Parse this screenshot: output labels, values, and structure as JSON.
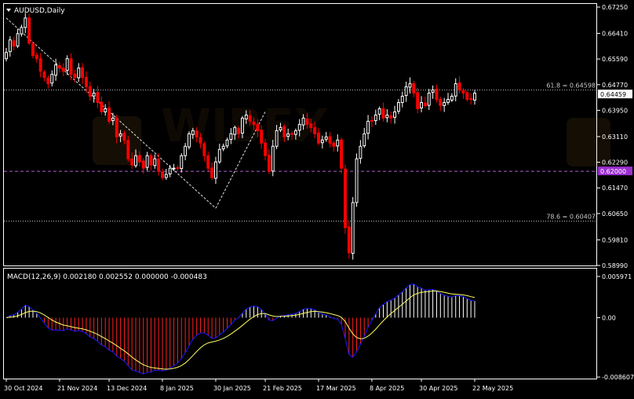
{
  "window": {
    "title": "AUDUSD,Daily",
    "collapse_icon": "triangle-down-icon"
  },
  "colors": {
    "background": "#000000",
    "frame": "#ffffff",
    "bull_candle": "#ffffff",
    "bear_candle": "#ff0000",
    "macd_line": "#1a1aff",
    "signal_line": "#ffff66",
    "hist_positive": "#ffffff",
    "hist_negative": "#ff2020",
    "fib_line": "#c0c0c0",
    "support_line": "#b060d0",
    "current_price_box": "#ffffff",
    "support_price_box": "#9b30d0"
  },
  "chart_data": [
    {
      "type": "candlestick",
      "title": "AUDUSD,Daily",
      "ylim": [
        0.5899,
        0.6725
      ],
      "y_ticks": [
        "0.67250",
        "0.66410",
        "0.65590",
        "0.64770",
        "0.63950",
        "0.63110",
        "0.62290",
        "0.61470",
        "0.60650",
        "0.59810",
        "0.58990"
      ],
      "x_ticks": [
        "30 Oct 2024",
        "21 Nov 2024",
        "13 Dec 2024",
        "8 Jan 2025",
        "30 Jan 2025",
        "21 Feb 2025",
        "17 Mar 2025",
        "8 Apr 2025",
        "30 Apr 2025",
        "22 May 2025"
      ],
      "grid": false,
      "current_price": "0.64459",
      "horizontal_levels": [
        {
          "label": "61.8 = 0.64598",
          "value": 0.64598,
          "style": "dotted"
        },
        {
          "label": "78.6 = 0.60407",
          "value": 0.60407,
          "style": "dotted"
        },
        {
          "label": "0.62000",
          "value": 0.62,
          "style": "dashed"
        }
      ],
      "trend_lines": [
        {
          "from": [
            "30 Oct 2024",
            0.669
          ],
          "to": [
            "30 Jan 2025",
            0.6082
          ]
        },
        {
          "from": [
            "30 Jan 2025",
            0.6082
          ],
          "to": [
            "21 Feb 2025",
            0.639
          ]
        }
      ],
      "closes": [
        0.658,
        0.662,
        0.66,
        0.664,
        0.666,
        0.669,
        0.661,
        0.657,
        0.656,
        0.652,
        0.65,
        0.648,
        0.651,
        0.654,
        0.653,
        0.652,
        0.656,
        0.651,
        0.65,
        0.653,
        0.65,
        0.647,
        0.644,
        0.645,
        0.642,
        0.639,
        0.64,
        0.636,
        0.637,
        0.631,
        0.632,
        0.63,
        0.624,
        0.622,
        0.625,
        0.623,
        0.621,
        0.625,
        0.622,
        0.624,
        0.62,
        0.618,
        0.619,
        0.621,
        0.621,
        0.621,
        0.625,
        0.628,
        0.632,
        0.633,
        0.631,
        0.629,
        0.625,
        0.621,
        0.618,
        0.623,
        0.627,
        0.628,
        0.63,
        0.632,
        0.634,
        0.632,
        0.637,
        0.638,
        0.636,
        0.635,
        0.633,
        0.629,
        0.625,
        0.62,
        0.628,
        0.633,
        0.634,
        0.631,
        0.632,
        0.632,
        0.633,
        0.635,
        0.637,
        0.635,
        0.634,
        0.632,
        0.629,
        0.63,
        0.631,
        0.629,
        0.628,
        0.63,
        0.621,
        0.602,
        0.594,
        0.61,
        0.624,
        0.628,
        0.632,
        0.636,
        0.636,
        0.638,
        0.64,
        0.637,
        0.638,
        0.637,
        0.639,
        0.642,
        0.644,
        0.647,
        0.648,
        0.645,
        0.64,
        0.642,
        0.641,
        0.645,
        0.646,
        0.643,
        0.641,
        0.642,
        0.643,
        0.644,
        0.648,
        0.646,
        0.645,
        0.643,
        0.643,
        0.645
      ]
    },
    {
      "type": "line",
      "title": "MACD(12,26,9) 0.002180 0.002552 0.000000 -0.000483",
      "ylim": [
        -0.0086,
        0.005971
      ],
      "y_ticks": [
        "0.005971",
        "0.00",
        "-0.008607"
      ],
      "series": [
        {
          "name": "MACD",
          "style": "histogram+line"
        },
        {
          "name": "Signal",
          "style": "line"
        }
      ]
    }
  ],
  "watermark": {
    "text": "WIBEX",
    "icon": "wibex-logo-icon"
  }
}
